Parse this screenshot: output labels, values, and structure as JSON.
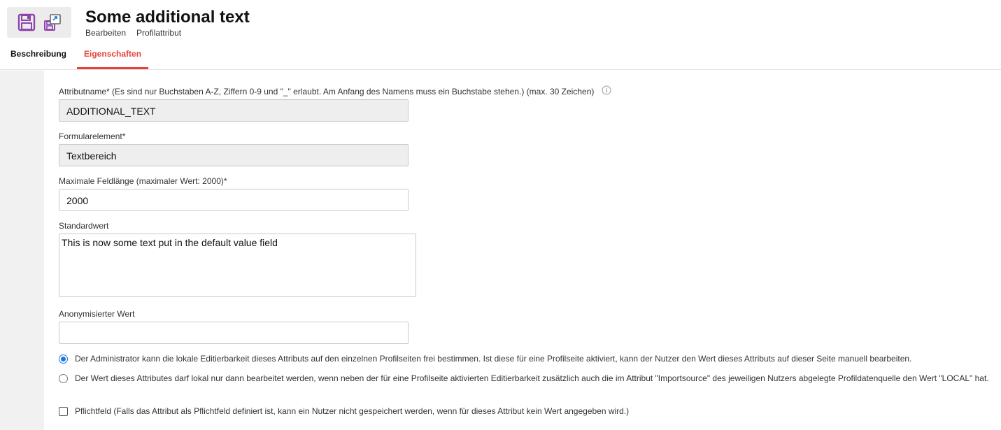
{
  "header": {
    "title": "Some additional text",
    "breadcrumbs": [
      "Bearbeiten",
      "Profilattribut"
    ]
  },
  "toolbar": {
    "save_icon": "save-icon",
    "save_as_icon": "save-copy-icon"
  },
  "tabs": [
    {
      "label": "Beschreibung",
      "active": false
    },
    {
      "label": "Eigenschaften",
      "active": true
    }
  ],
  "form": {
    "attribute_name": {
      "label": "Attributname* (Es sind nur Buchstaben A-Z, Ziffern 0-9 und \"_\" erlaubt. Am Anfang des Namens muss ein Buchstabe stehen.) (max. 30 Zeichen)",
      "value": "ADDITIONAL_TEXT",
      "info_icon": "info-icon"
    },
    "form_element": {
      "label": "Formularelement*",
      "value": "Textbereich"
    },
    "max_length": {
      "label": "Maximale Feldlänge (maximaler Wert: 2000)*",
      "value": "2000"
    },
    "default_value": {
      "label": "Standardwert",
      "value": "This is now some text put in the default value field"
    },
    "anonymized_value": {
      "label": "Anonymisierter Wert",
      "value": ""
    },
    "editability_options": [
      {
        "label": "Der Administrator kann die lokale Editierbarkeit dieses Attributs auf den einzelnen Profilseiten frei bestimmen. Ist diese für eine Profilseite aktiviert, kann der Nutzer den Wert dieses Attributs auf dieser Seite manuell bearbeiten.",
        "checked": true
      },
      {
        "label": "Der Wert dieses Attributes darf lokal nur dann bearbeitet werden, wenn neben der für eine Profilseite aktivierten Editierbarkeit zusätzlich auch die im Attribut \"Importsource\" des jeweiligen Nutzers abgelegte Profildatenquelle den Wert \"LOCAL\" hat.",
        "checked": false
      }
    ],
    "required": {
      "label": "Pflichtfeld (Falls das Attribut als Pflichtfeld definiert ist, kann ein Nutzer nicht gespeichert werden, wenn für dieses Attribut kein Wert angegeben wird.)",
      "checked": false
    }
  },
  "colors": {
    "accent": "#e8413a",
    "radio_selected": "#1a73e8",
    "icon_purple": "#8e44ad"
  }
}
